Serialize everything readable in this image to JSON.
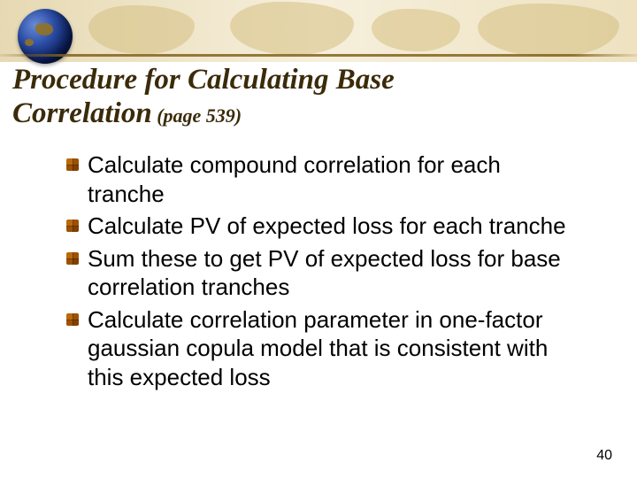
{
  "header": {
    "title_line1": "Procedure for Calculating Base",
    "title_line2_main": "Correlation",
    "title_line2_page": " (page 539)"
  },
  "bullets": [
    "Calculate compound correlation for each tranche",
    "Calculate PV of expected loss for each tranche",
    "Sum these to get PV of expected loss for base correlation tranches",
    "Calculate correlation parameter in one-factor gaussian copula model that is consistent with this expected loss"
  ],
  "page_number": "40"
}
